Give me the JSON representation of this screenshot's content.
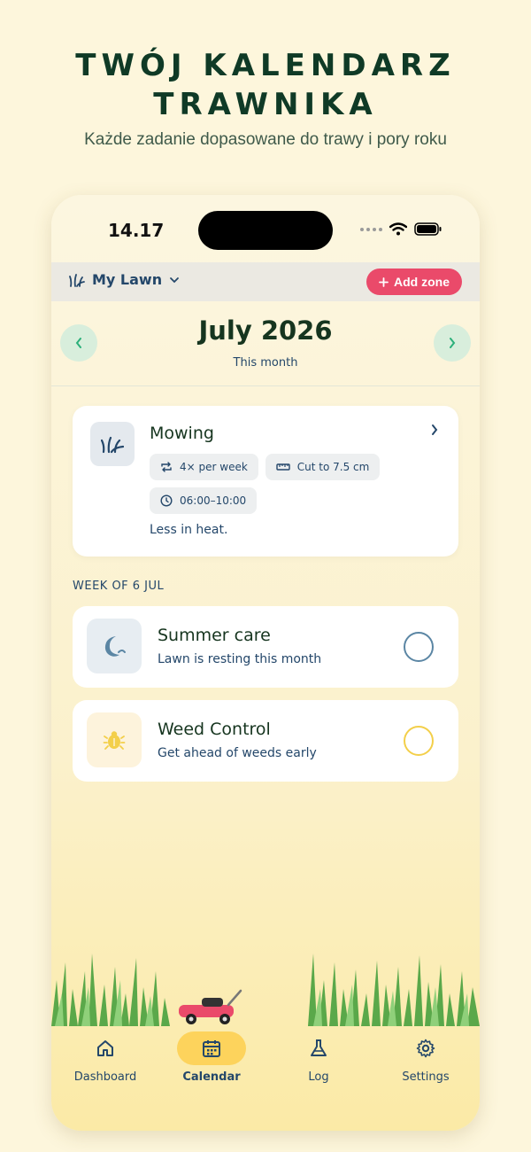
{
  "promo": {
    "title_line1": "TWÓJ KALENDARZ",
    "title_line2": "TRAWNIKA",
    "subtitle": "Każde zadanie dopasowane do trawy i pory roku"
  },
  "status_bar": {
    "time": "14.17"
  },
  "header": {
    "zone_name": "My Lawn",
    "add_zone_label": "Add zone"
  },
  "month": {
    "title": "July 2026",
    "subtitle": "This month"
  },
  "task": {
    "title": "Mowing",
    "chips": [
      "4× per week",
      "Cut to 7.5 cm",
      "06:00–10:00"
    ],
    "note": "Less in heat."
  },
  "week": {
    "label": "WEEK OF 6 JUL",
    "items": [
      {
        "title": "Summer care",
        "subtitle": "Lawn is resting this month",
        "icon": "moon-icon",
        "accent": "#5b86a4",
        "icon_bg": "#e7edf2"
      },
      {
        "title": "Weed Control",
        "subtitle": "Get ahead of weeds early",
        "icon": "bug-icon",
        "accent": "#f3cf4a",
        "icon_bg": "#fdf3dc"
      }
    ]
  },
  "tabs": [
    {
      "label": "Dashboard",
      "icon": "home-icon",
      "active": false
    },
    {
      "label": "Calendar",
      "icon": "calendar-icon",
      "active": true
    },
    {
      "label": "Log",
      "icon": "flask-icon",
      "active": false
    },
    {
      "label": "Settings",
      "icon": "gear-icon",
      "active": false
    }
  ],
  "colors": {
    "brand_green": "#0f3a26",
    "accent_pink": "#ea4a6a",
    "nav_mint": "#d8eedc",
    "text_blue": "#24476a",
    "active_tab": "#fdd35c"
  }
}
